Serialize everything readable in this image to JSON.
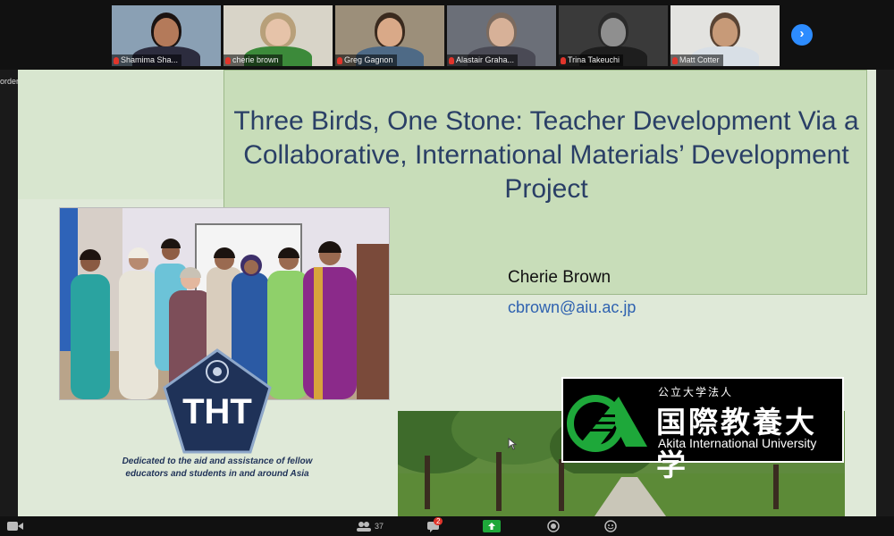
{
  "participants": [
    {
      "name": "Shamima Sha...",
      "skin": "#b47a5a",
      "hair": "#1b1311",
      "shirt": "#2c2c3e",
      "bg": "#8aa0b4"
    },
    {
      "name": "cherie brown",
      "skin": "#e6c3a9",
      "hair": "#b8a07a",
      "shirt": "#3c8a3a",
      "bg": "#d8d4c8"
    },
    {
      "name": "Greg Gagnon",
      "skin": "#d9a988",
      "hair": "#3a2a1e",
      "shirt": "#4e6a86",
      "bg": "#9c8f7a"
    },
    {
      "name": "Alastair Graha...",
      "skin": "#d7b198",
      "hair": "#7b6a5e",
      "shirt": "#4a4a55",
      "bg": "#6b6f78"
    },
    {
      "name": "Trina Takeuchi",
      "skin": "#8f8f8f",
      "hair": "#2a2a2a",
      "shirt": "#1e1e1e",
      "bg": "#3a3a3a"
    },
    {
      "name": "Matt Cotter",
      "skin": "#c79a78",
      "hair": "#5a4434",
      "shirt": "#d8dfe6",
      "bg": "#e3e3e0"
    }
  ],
  "next_participants_icon": "chevron-right-icon",
  "recorder_label": "order",
  "slide": {
    "title": "Three Birds, One Stone: Teacher Development Via a Collaborative, International Materials’ Development Project",
    "presenter_name": "Cherie Brown",
    "presenter_email": "cbrown@aiu.ac.jp",
    "tht_logo_text": "THT",
    "tht_caption": "Dedicated to the aid and assistance of fellow educators and students in and around Asia",
    "aiu_logo": {
      "jp_small": "公立大学法人",
      "jp_large": "国際教養大学",
      "en": "Akita International University"
    }
  },
  "toolbar": {
    "participants_count": "37",
    "chat_badge": "2"
  },
  "colors": {
    "slide_bg": "#dfe9d8",
    "title_box": "#c8ddb9",
    "title_text": "#2a3f66",
    "email_link": "#2f62b0",
    "zoom_blue": "#2d8cff",
    "tht_navy": "#1f3258",
    "aiu_green": "#1ea83a"
  }
}
